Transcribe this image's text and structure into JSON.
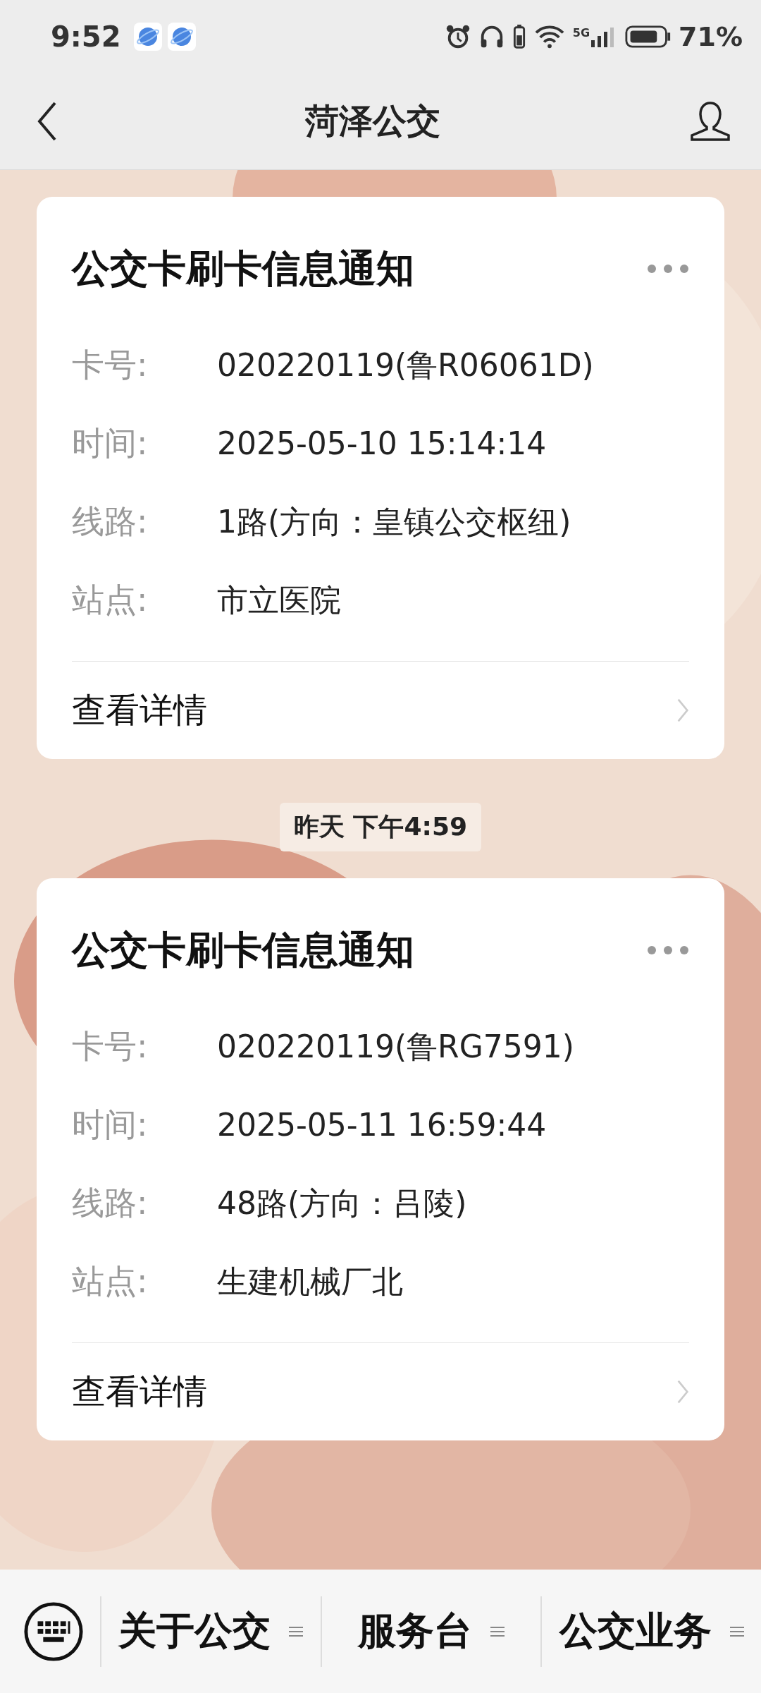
{
  "status_bar": {
    "time": "9:52",
    "battery": "71%",
    "network": "5G"
  },
  "header": {
    "title": "菏泽公交"
  },
  "messages": [
    {
      "kind": "card",
      "title": "公交卡刷卡信息通知",
      "fields": [
        {
          "label": "卡号:",
          "value": "020220119(鲁R06061D)"
        },
        {
          "label": "时间:",
          "value": "2025-05-10 15:14:14"
        },
        {
          "label": "线路:",
          "value": "1路(方向：皇镇公交枢纽)"
        },
        {
          "label": "站点:",
          "value": "市立医院"
        }
      ],
      "link": "查看详情"
    },
    {
      "kind": "time",
      "text": "昨天 下午4:59"
    },
    {
      "kind": "card",
      "title": "公交卡刷卡信息通知",
      "fields": [
        {
          "label": "卡号:",
          "value": "020220119(鲁RG7591)"
        },
        {
          "label": "时间:",
          "value": "2025-05-11 16:59:44"
        },
        {
          "label": "线路:",
          "value": "48路(方向：吕陵)"
        },
        {
          "label": "站点:",
          "value": "生建机械厂北"
        }
      ],
      "link": "查看详情"
    }
  ],
  "menu": [
    {
      "label": "关于公交"
    },
    {
      "label": "服务台"
    },
    {
      "label": "公交业务"
    }
  ]
}
